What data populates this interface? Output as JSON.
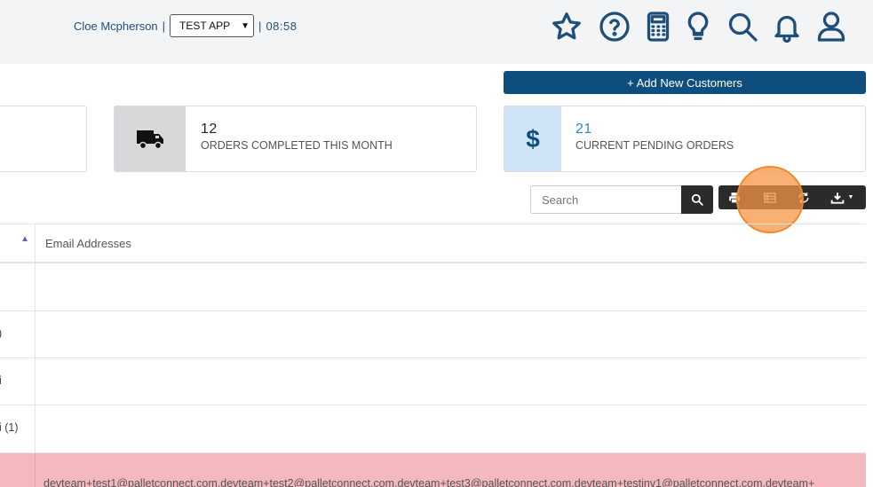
{
  "header": {
    "user_name": "Cloe Mcpherson",
    "separator": "|",
    "app_selected": "TEST APP",
    "time": "08:58",
    "icons": [
      "star-icon",
      "help-icon",
      "calculator-icon",
      "lightbulb-icon",
      "search-icon",
      "bell-icon",
      "user-icon"
    ]
  },
  "actions": {
    "add_customers": "+ Add New Customers"
  },
  "stats": [
    {
      "value": "12",
      "label": "ORDERS COMPLETED THIS MONTH",
      "icon": "truck-icon"
    },
    {
      "value": "21",
      "label": "CURRENT PENDING ORDERS",
      "icon": "dollar-icon"
    }
  ],
  "toolbar": {
    "search_placeholder": "Search",
    "buttons": [
      "print-icon",
      "table-view-icon",
      "refresh-icon",
      "download-icon"
    ]
  },
  "table": {
    "column_email": "Email Addresses",
    "rows": [
      {
        "left": "",
        "email": ""
      },
      {
        "left": ")",
        "email": ""
      },
      {
        "left": "i",
        "email": ""
      },
      {
        "left": "i (1)",
        "email": ""
      },
      {
        "left": "",
        "email": "devteam+test1@palletconnect.com,devteam+test2@palletconnect.com,devteam+test3@palletconnect.com,devteam+testinv1@palletconnect.com,devteam+"
      }
    ]
  },
  "colors": {
    "brand": "#0d4e7f",
    "header_icon": "#1f4e79",
    "highlight_row": "#f3b9bf",
    "pending_value": "#2a8ac7",
    "click_marker": "#f79646"
  }
}
